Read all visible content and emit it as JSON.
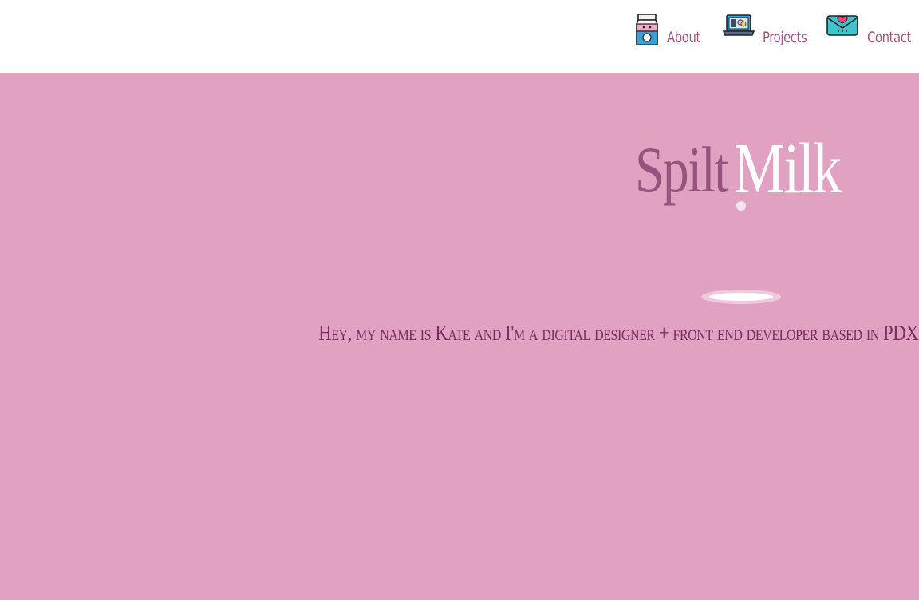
{
  "nav": {
    "items": [
      {
        "label": "About",
        "icon": "milk-carton-icon"
      },
      {
        "label": "Projects",
        "icon": "laptop-icon"
      },
      {
        "label": "Contact",
        "icon": "envelope-heart-icon"
      }
    ]
  },
  "hero": {
    "title_part1": "Spilt",
    "title_part2": "Milk",
    "tagline": "Hey, my name is Kate and I'm a digital designer + front end developer based in PDX."
  },
  "colors": {
    "background": "#e1a2c1",
    "header": "#ffffff",
    "accent": "#98527e",
    "milk": "#ffffff"
  }
}
